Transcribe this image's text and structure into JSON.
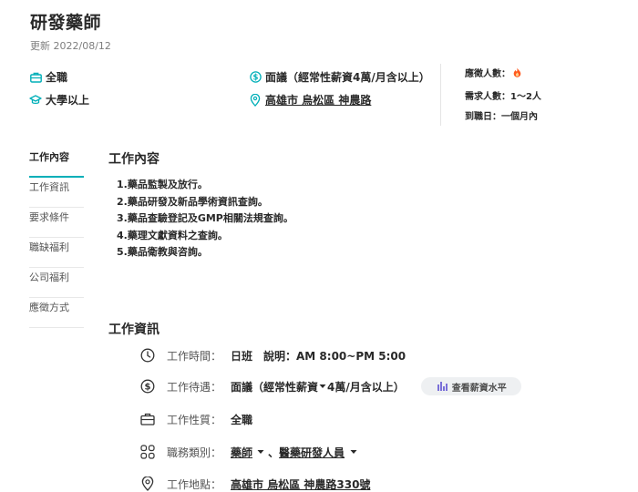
{
  "header": {
    "title": "研發藥師",
    "updated": "更新 2022/08/12"
  },
  "summary": {
    "job_type": "全職",
    "education": "大學以上",
    "salary": "面議（經常性薪資4萬/月含以上）",
    "location": "高雄市 烏松區 神農路"
  },
  "side_info": {
    "applicants": "應徵人數：",
    "headcount": "需求人數：1～2人",
    "start": "到職日：一個月內"
  },
  "nav": {
    "items": [
      "工作內容",
      "工作資訊",
      "要求條件",
      "職缺福利",
      "公司福利",
      "應徵方式"
    ]
  },
  "content": {
    "section_title": "工作內容",
    "lines": [
      "1.藥品監製及放行。",
      "2.藥品研發及新品學術資訊查詢。",
      "3.藥品查驗登記及GMP相關法規查詢。",
      "4.藥理文獻資料之查詢。",
      "5.藥品衛教與咨詢。"
    ]
  },
  "job_info": {
    "section_title": "工作資訊",
    "time_label": "工作時間：",
    "time_value": "日班　說明：AM 8:00~PM 5:00",
    "pay_label": "工作待遇：",
    "pay_value_a": "面議（經常性薪資",
    "pay_value_b": "4萬/月含以上）",
    "salary_button": "查看薪資水平",
    "type_label": "工作性質：",
    "type_value": "全職",
    "category_label": "職務類別：",
    "category_1": "藥師",
    "category_sep": "、",
    "category_2": "醫藥研發人員",
    "location_label": "工作地點：",
    "location_value": "高雄市 烏松區 神農路330號"
  },
  "colors": {
    "accent": "#00afb8",
    "text": "#292929",
    "muted": "#7e7e7e",
    "fire": "#ff5a1f",
    "bars": "#7a6fd8"
  }
}
